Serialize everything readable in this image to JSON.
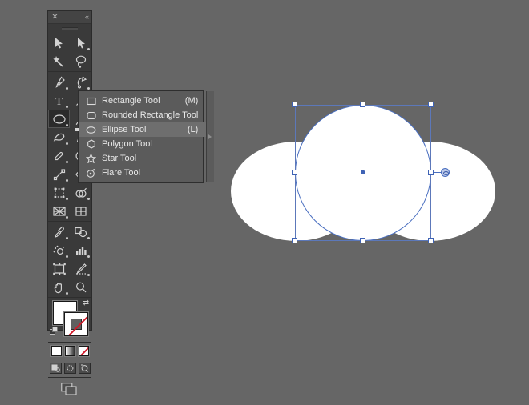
{
  "app": {
    "background_color": "#666666",
    "panel_color": "#3a3a3a",
    "accent_color": "#3f63b5",
    "menu_color": "#5b5b5b",
    "menu_highlight_color": "#6e6e6e"
  },
  "tool_panel": {
    "title": "Tools",
    "close_glyph": "✕",
    "collapse_glyph": "«",
    "groups": [
      {
        "name": "selection-group",
        "rows": [
          [
            {
              "icon": "selection-tool-icon",
              "label": "Selection Tool",
              "has_flyout": false,
              "active": false
            },
            {
              "icon": "direct-selection-tool-icon",
              "label": "Direct Selection Tool",
              "has_flyout": true,
              "active": false
            }
          ],
          [
            {
              "icon": "magic-wand-tool-icon",
              "label": "Magic Wand Tool",
              "has_flyout": false,
              "active": false
            },
            {
              "icon": "lasso-tool-icon",
              "label": "Lasso Tool",
              "has_flyout": false,
              "active": false
            }
          ]
        ]
      },
      {
        "name": "drawing-group",
        "rows": [
          [
            {
              "icon": "pen-tool-icon",
              "label": "Pen Tool",
              "has_flyout": true,
              "active": false
            },
            {
              "icon": "curvature-tool-icon",
              "label": "Curvature Tool",
              "has_flyout": true,
              "active": false
            }
          ],
          [
            {
              "icon": "type-tool-icon",
              "label": "Type Tool",
              "has_flyout": true,
              "active": false
            },
            {
              "icon": "line-segment-tool-icon",
              "label": "Line Segment Tool",
              "has_flyout": true,
              "active": false
            }
          ],
          [
            {
              "icon": "ellipse-tool-icon",
              "label": "Ellipse Tool",
              "has_flyout": true,
              "active": true
            },
            {
              "icon": "paintbrush-tool-icon",
              "label": "Paintbrush Tool",
              "has_flyout": true,
              "active": false
            }
          ],
          [
            {
              "icon": "shaper-tool-icon",
              "label": "Shaper Tool",
              "has_flyout": true,
              "active": false
            },
            {
              "icon": "pencil-tool-icon",
              "label": "Pencil Tool",
              "has_flyout": true,
              "active": false
            }
          ],
          [
            {
              "icon": "eraser-tool-icon",
              "label": "Eraser Tool",
              "has_flyout": true,
              "active": false
            },
            {
              "icon": "rotate-tool-icon",
              "label": "Rotate Tool",
              "has_flyout": true,
              "active": false
            }
          ],
          [
            {
              "icon": "scale-tool-icon",
              "label": "Scale Tool",
              "has_flyout": true,
              "active": false
            },
            {
              "icon": "width-tool-icon",
              "label": "Width Tool",
              "has_flyout": true,
              "active": false
            }
          ],
          [
            {
              "icon": "free-transform-tool-icon",
              "label": "Free Transform Tool",
              "has_flyout": true,
              "active": false
            },
            {
              "icon": "shape-builder-tool-icon",
              "label": "Shape Builder Tool",
              "has_flyout": true,
              "active": false
            }
          ],
          [
            {
              "icon": "perspective-grid-tool-icon",
              "label": "Perspective Grid Tool",
              "has_flyout": true,
              "active": false
            },
            {
              "icon": "mesh-tool-icon",
              "label": "Mesh Tool",
              "has_flyout": false,
              "active": false
            }
          ]
        ]
      },
      {
        "name": "utility-group",
        "rows": [
          [
            {
              "icon": "eyedropper-tool-icon",
              "label": "Eyedropper Tool",
              "has_flyout": true,
              "active": false
            },
            {
              "icon": "blend-tool-icon",
              "label": "Blend Tool",
              "has_flyout": true,
              "active": false
            }
          ],
          [
            {
              "icon": "symbol-sprayer-tool-icon",
              "label": "Symbol Sprayer Tool",
              "has_flyout": true,
              "active": false
            },
            {
              "icon": "column-graph-tool-icon",
              "label": "Column Graph Tool",
              "has_flyout": true,
              "active": false
            }
          ],
          [
            {
              "icon": "artboard-tool-icon",
              "label": "Artboard Tool",
              "has_flyout": false,
              "active": false
            },
            {
              "icon": "slice-tool-icon",
              "label": "Slice Tool",
              "has_flyout": true,
              "active": false
            }
          ],
          [
            {
              "icon": "hand-tool-icon",
              "label": "Hand Tool",
              "has_flyout": true,
              "active": false
            },
            {
              "icon": "zoom-tool-icon",
              "label": "Zoom Tool",
              "has_flyout": false,
              "active": false
            }
          ]
        ]
      }
    ],
    "swatches": {
      "fill_name": "fill-swatch",
      "fill_color": "#ffffff",
      "stroke_name": "stroke-swatch",
      "stroke_color": "#ffffff",
      "stroke_is_none": true,
      "none_slash_color": "#d11a2a",
      "swap_glyph": "⇄",
      "default_label": "default-fill-stroke"
    },
    "paint_modes": [
      {
        "name": "color-button",
        "label": "Color"
      },
      {
        "name": "gradient-button",
        "label": "Gradient"
      },
      {
        "name": "none-button",
        "label": "None"
      }
    ],
    "draw_modes": [
      {
        "name": "draw-normal-button",
        "label": "Draw Normal",
        "active": true
      },
      {
        "name": "draw-behind-button",
        "label": "Draw Behind",
        "active": false
      },
      {
        "name": "draw-inside-button",
        "label": "Draw Inside",
        "active": false
      }
    ],
    "screen_mode": {
      "name": "change-screen-mode-button",
      "label": "Change Screen Mode"
    }
  },
  "flyout_menu": {
    "name": "shape-tools-flyout",
    "selected_index": 2,
    "items": [
      {
        "icon": "rectangle-icon",
        "label": "Rectangle Tool",
        "shortcut": "(M)"
      },
      {
        "icon": "rounded-rectangle-icon",
        "label": "Rounded Rectangle Tool",
        "shortcut": ""
      },
      {
        "icon": "ellipse-icon",
        "label": "Ellipse Tool",
        "shortcut": "(L)"
      },
      {
        "icon": "polygon-icon",
        "label": "Polygon Tool",
        "shortcut": ""
      },
      {
        "icon": "star-icon",
        "label": "Star Tool",
        "shortcut": ""
      },
      {
        "icon": "flare-icon",
        "label": "Flare Tool",
        "shortcut": ""
      }
    ],
    "tear_off_label": "Tear off"
  },
  "canvas": {
    "name": "artboard",
    "shapes": [
      {
        "name": "ellipse-left",
        "type": "ellipse",
        "fill": "#ffffff",
        "selected": false
      },
      {
        "name": "ellipse-right",
        "type": "ellipse",
        "fill": "#ffffff",
        "selected": false
      },
      {
        "name": "ellipse-center",
        "type": "ellipse",
        "fill": "#ffffff",
        "selected": true
      }
    ],
    "selection": {
      "name": "selection-bounding-box",
      "stroke_color": "#5c78ba",
      "handle_fill": "#ffffff",
      "handle_stroke": "#3f63b5",
      "handles": [
        "handle-top-left",
        "handle-top-center",
        "handle-top-right",
        "handle-middle-left",
        "handle-middle-right",
        "handle-bottom-left",
        "handle-bottom-center",
        "handle-bottom-right"
      ],
      "center_point_name": "selection-center-point"
    },
    "cursor": {
      "name": "ellipse-resize-cursor",
      "label": "Resize cursor"
    }
  }
}
